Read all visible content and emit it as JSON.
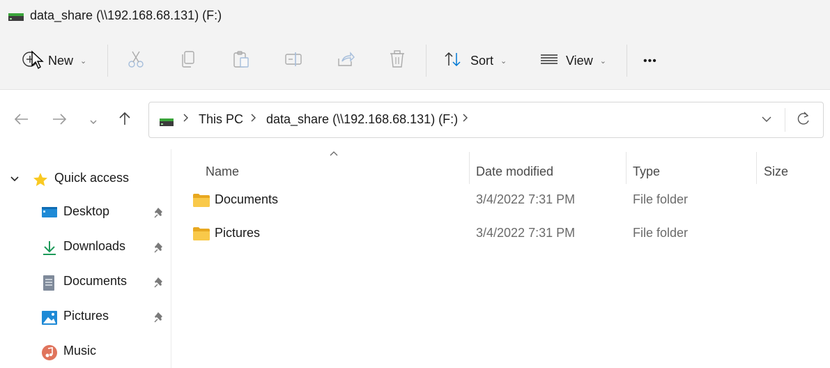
{
  "window": {
    "title": "data_share (\\\\192.168.68.131) (F:)",
    "drive_icon": "network-drive-icon"
  },
  "commandbar": {
    "new_label": "New",
    "sort_label": "Sort",
    "view_label": "View",
    "more_label": "•••",
    "disabled_tools": [
      "cut-icon",
      "copy-icon",
      "paste-icon",
      "rename-icon",
      "share-icon",
      "delete-icon"
    ]
  },
  "address": {
    "crumbs": [
      "This PC",
      "data_share (\\\\192.168.68.131) (F:)"
    ]
  },
  "sidebar": {
    "quick_access": "Quick access",
    "items": [
      {
        "label": "Desktop",
        "icon": "desktop-icon",
        "pinned": true
      },
      {
        "label": "Downloads",
        "icon": "downloads-icon",
        "pinned": true
      },
      {
        "label": "Documents",
        "icon": "documents-icon",
        "pinned": true
      },
      {
        "label": "Pictures",
        "icon": "pictures-icon",
        "pinned": true
      },
      {
        "label": "Music",
        "icon": "music-icon",
        "pinned": false
      }
    ]
  },
  "files": {
    "columns": {
      "name": "Name",
      "date": "Date modified",
      "type": "Type",
      "size": "Size"
    },
    "rows": [
      {
        "name": "Documents",
        "date": "3/4/2022 7:31 PM",
        "type": "File folder",
        "size": ""
      },
      {
        "name": "Pictures",
        "date": "3/4/2022 7:31 PM",
        "type": "File folder",
        "size": ""
      }
    ]
  },
  "colors": {
    "toolbar_bg": "#f3f3f3",
    "folder_yellow": "#f4c443",
    "drive_green": "#3aa53a",
    "star_yellow": "#f9c922",
    "accent_blue": "#0078d4"
  }
}
